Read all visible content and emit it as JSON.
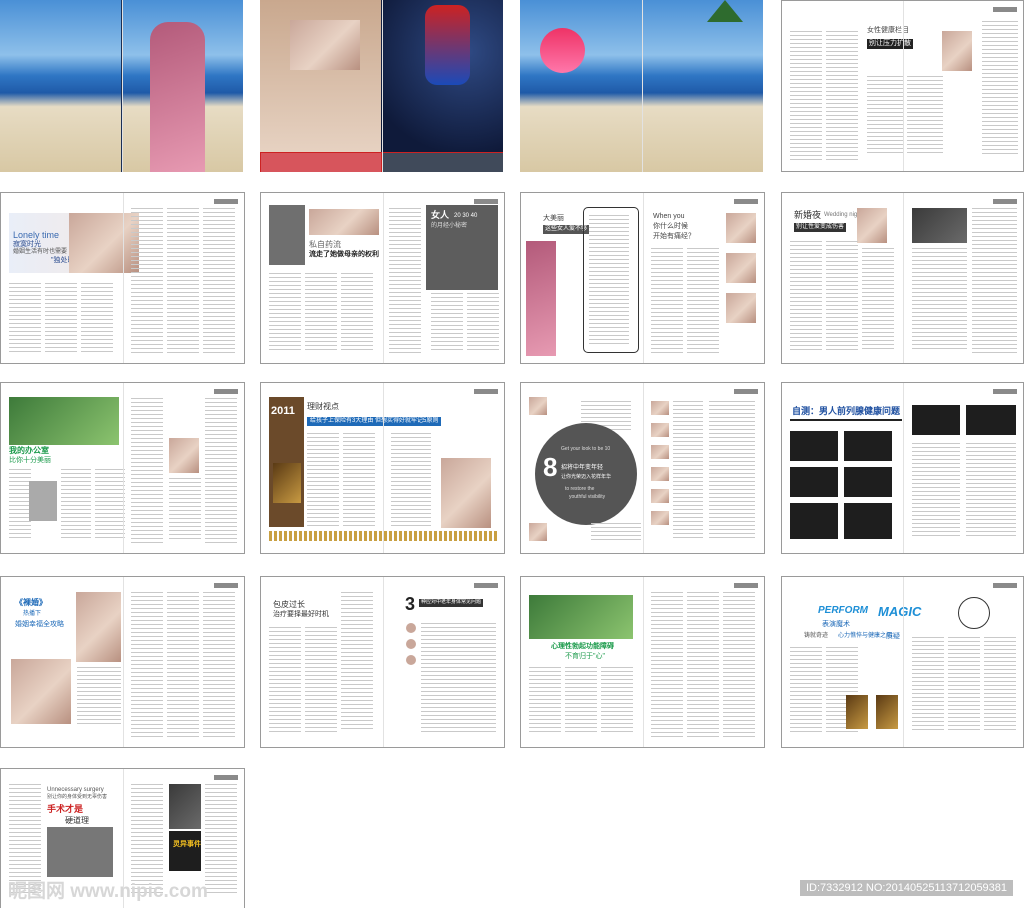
{
  "watermark_left": "昵图网 www.nipic.com",
  "watermark_right": "ID:7332912 NO:20140525113712059381",
  "spreads": {
    "p4": {
      "title1": "女性健康栏目",
      "title2": "别让压力扩散"
    },
    "p5": {
      "title1": "Lonely time",
      "title2": "寂寞时光",
      "title3": "婚姻生活有时也需要",
      "title4": "\"独处时光\""
    },
    "p6": {
      "title1": "私自药流",
      "title2": "流走了她做母亲的权利",
      "box_title": "女人",
      "box_sub": "20 30 40",
      "box_sub2": "的月经小秘密"
    },
    "p7": {
      "title1": "大美丽",
      "title2": "这些女人爱不够",
      "right_title1": "When you",
      "right_title2": "你什么时候",
      "right_title3": "开始有痛经？"
    },
    "p8": {
      "title1": "新婚夜",
      "title2": "Wedding night",
      "title3": "别让性爱变成伤害"
    },
    "p9": {
      "title1": "我的办公室",
      "title2": "比你十分美丽"
    },
    "p10": {
      "year": "2011",
      "title1": "理财视点",
      "title2": "给孩子上保险有3大理由 但想买得好就牢记5原则"
    },
    "p11": {
      "circle_num": "8",
      "circle_text1": "招将中年变年轻",
      "circle_text2": "让你光荣迈入花样年华",
      "circle_en1": "Get your look to be 10",
      "circle_en2": "to restore the",
      "circle_en3": "youthful visibility"
    },
    "p12": {
      "title1": "自测：男人前列腺健康问题"
    },
    "p13": {
      "title1": "《裸婚》",
      "title2": "热播下",
      "title3": "婚姻幸福全攻略"
    },
    "p14": {
      "title1": "包皮过长",
      "title2": "治疗要择最好时机",
      "num": "3",
      "subtitle": "种应对中老年身体常见问题"
    },
    "p15": {
      "title1": "心理性勃起功能障碍",
      "title2": "不育归于\"心\""
    },
    "p16": {
      "perform": "PERFORM",
      "magic": "MAGIC",
      "title1": "表演魔术",
      "title2": "铸就奇迹",
      "title3": "心力憔悴与健康之间",
      "title4": "质疑"
    },
    "p17": {
      "title1": "Unnecessary surgery",
      "title2": "别让你的身体受到无辜伤害",
      "title3": "手术才是",
      "title4": "硬道理",
      "box_title": "灵异事件"
    }
  }
}
